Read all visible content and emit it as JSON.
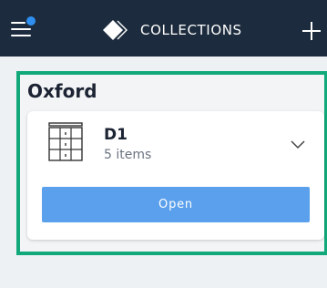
{
  "header": {
    "title": "COLLECTIONS",
    "menu_icon": "hamburger-menu-icon",
    "notification_dot_color": "#2f8ff0",
    "logo_icon": "diamond-logo-icon",
    "add_icon": "plus-icon",
    "background_color": "#1c2b3d"
  },
  "location": {
    "name": "Oxford",
    "highlight_color": "#11a97a",
    "collections": [
      {
        "icon": "drawer-cabinet-icon",
        "name": "D1",
        "item_count": "5 items",
        "expand_icon": "chevron-down-icon",
        "open_label": "Open",
        "button_color": "#5aa0ec"
      }
    ]
  }
}
